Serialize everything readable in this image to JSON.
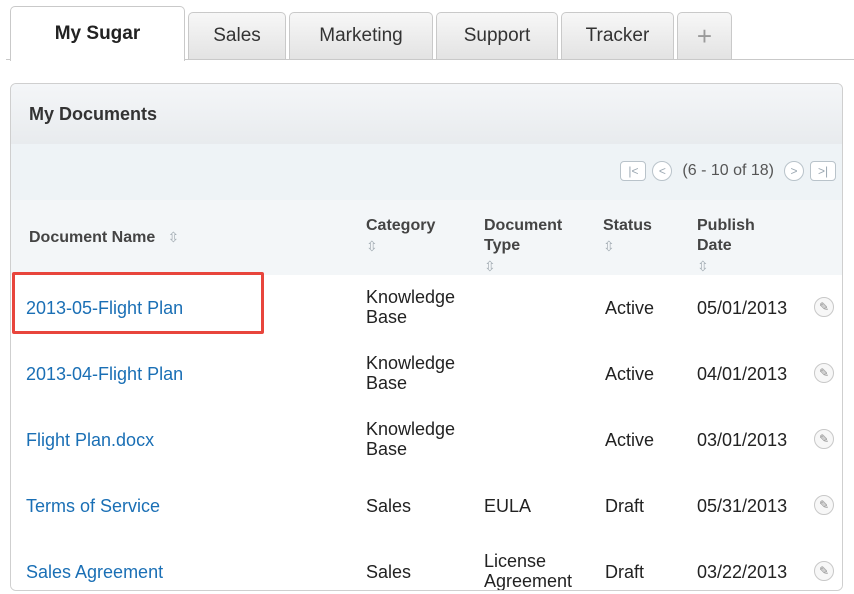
{
  "tabs": [
    {
      "label": "My Sugar"
    },
    {
      "label": "Sales"
    },
    {
      "label": "Marketing"
    },
    {
      "label": "Support"
    },
    {
      "label": "Tracker"
    },
    {
      "label": "+"
    }
  ],
  "dashlet": {
    "title": "My Documents",
    "pager": {
      "first_icon": "first-page-icon",
      "prev_icon": "previous-page-icon",
      "text": "(6 - 10 of 18)",
      "next_icon": "next-page-icon",
      "last_icon": "last-page-icon"
    },
    "columns": [
      {
        "label": "Document Name",
        "sort_icon": "sort-icon"
      },
      {
        "label": "Category",
        "sort_icon": "sort-icon"
      },
      {
        "label": "Document Type",
        "sort_icon": "sort-icon"
      },
      {
        "label": "Status",
        "sort_icon": "sort-icon"
      },
      {
        "label": "Publish Date",
        "sort_icon": "sort-icon"
      }
    ],
    "rows": [
      {
        "name": "2013-05-Flight Plan",
        "category": "Knowledge Base",
        "type": "",
        "status": "Active",
        "date": "05/01/2013"
      },
      {
        "name": "2013-04-Flight Plan",
        "category": "Knowledge Base",
        "type": "",
        "status": "Active",
        "date": "04/01/2013"
      },
      {
        "name": "Flight Plan.docx",
        "category": "Knowledge Base",
        "type": "",
        "status": "Active",
        "date": "03/01/2013"
      },
      {
        "name": "Terms of Service",
        "category": "Sales",
        "type": "EULA",
        "status": "Draft",
        "date": "05/31/2013"
      },
      {
        "name": "Sales Agreement",
        "category": "Sales",
        "type": "License Agreement",
        "status": "Draft",
        "date": "03/22/2013"
      }
    ]
  },
  "colors": {
    "link": "#1a6fb5",
    "highlight": "#e8453c"
  }
}
